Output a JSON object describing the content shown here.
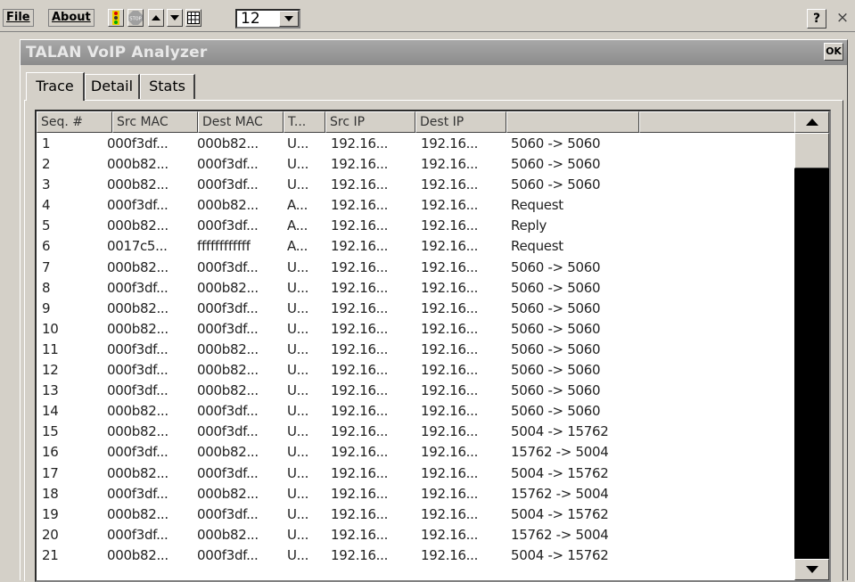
{
  "menubar": {
    "file_label": "File",
    "about_label": "About",
    "zoom_value": "12",
    "help_label": "?",
    "close_label": "×"
  },
  "toolbar_icons": [
    "traffic-light-icon",
    "stop-icon",
    "arrow-up-icon",
    "arrow-down-icon",
    "grid-icon"
  ],
  "window": {
    "title": "TALAN VoIP Analyzer",
    "ok_label": "OK"
  },
  "tabs": [
    {
      "label": "Trace",
      "active": true
    },
    {
      "label": "Detail",
      "active": false
    },
    {
      "label": "Stats",
      "active": false
    }
  ],
  "table": {
    "columns": [
      "Seq. #",
      "Src MAC",
      "Dest MAC",
      "T...",
      "Src IP",
      "Dest IP",
      ""
    ],
    "rows": [
      [
        "1",
        "000f3df...",
        "000b82...",
        "U...",
        "192.16...",
        "192.16...",
        "5060 -> 5060"
      ],
      [
        "2",
        "000b82...",
        "000f3df...",
        "U...",
        "192.16...",
        "192.16...",
        "5060 -> 5060"
      ],
      [
        "3",
        "000b82...",
        "000f3df...",
        "U...",
        "192.16...",
        "192.16...",
        "5060 -> 5060"
      ],
      [
        "4",
        "000f3df...",
        "000b82...",
        "A...",
        "192.16...",
        "192.16...",
        "Request"
      ],
      [
        "5",
        "000b82...",
        "000f3df...",
        "A...",
        "192.16...",
        "192.16...",
        "Reply"
      ],
      [
        "6",
        "0017c5...",
        "ffffffffffff",
        "A...",
        "192.16...",
        "192.16...",
        "Request"
      ],
      [
        "7",
        "000b82...",
        "000f3df...",
        "U...",
        "192.16...",
        "192.16...",
        "5060 -> 5060"
      ],
      [
        "8",
        "000f3df...",
        "000b82...",
        "U...",
        "192.16...",
        "192.16...",
        "5060 -> 5060"
      ],
      [
        "9",
        "000b82...",
        "000f3df...",
        "U...",
        "192.16...",
        "192.16...",
        "5060 -> 5060"
      ],
      [
        "10",
        "000b82...",
        "000f3df...",
        "U...",
        "192.16...",
        "192.16...",
        "5060 -> 5060"
      ],
      [
        "11",
        "000f3df...",
        "000b82...",
        "U...",
        "192.16...",
        "192.16...",
        "5060 -> 5060"
      ],
      [
        "12",
        "000f3df...",
        "000b82...",
        "U...",
        "192.16...",
        "192.16...",
        "5060 -> 5060"
      ],
      [
        "13",
        "000f3df...",
        "000b82...",
        "U...",
        "192.16...",
        "192.16...",
        "5060 -> 5060"
      ],
      [
        "14",
        "000b82...",
        "000f3df...",
        "U...",
        "192.16...",
        "192.16...",
        "5060 -> 5060"
      ],
      [
        "15",
        "000b82...",
        "000f3df...",
        "U...",
        "192.16...",
        "192.16...",
        "5004 -> 15762"
      ],
      [
        "16",
        "000f3df...",
        "000b82...",
        "U...",
        "192.16...",
        "192.16...",
        "15762 -> 5004"
      ],
      [
        "17",
        "000b82...",
        "000f3df...",
        "U...",
        "192.16...",
        "192.16...",
        "5004 -> 15762"
      ],
      [
        "18",
        "000f3df...",
        "000b82...",
        "U...",
        "192.16...",
        "192.16...",
        "15762 -> 5004"
      ],
      [
        "19",
        "000b82...",
        "000f3df...",
        "U...",
        "192.16...",
        "192.16...",
        "5004 -> 15762"
      ],
      [
        "20",
        "000f3df...",
        "000b82...",
        "U...",
        "192.16...",
        "192.16...",
        "15762 -> 5004"
      ],
      [
        "21",
        "000b82...",
        "000f3df...",
        "U...",
        "192.16...",
        "192.16...",
        "5004 -> 15762"
      ]
    ]
  }
}
